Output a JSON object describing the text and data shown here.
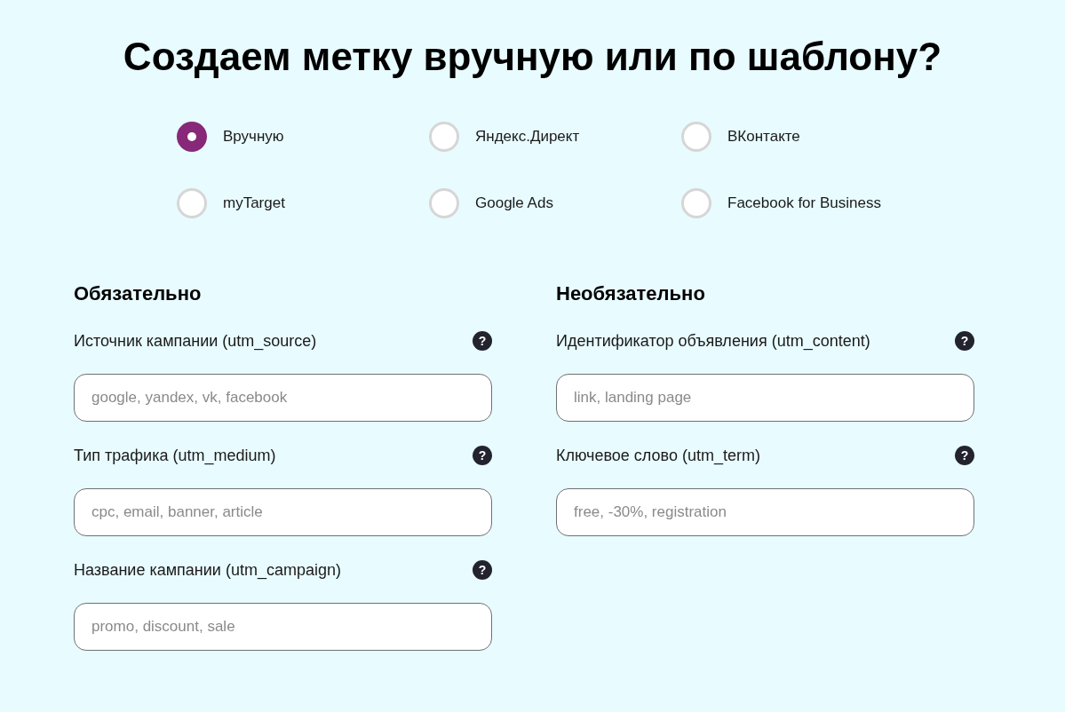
{
  "title": "Создаем метку вручную или по шаблону?",
  "options": [
    {
      "label": "Вручную",
      "selected": true
    },
    {
      "label": "Яндекс.Директ",
      "selected": false
    },
    {
      "label": "ВКонтакте",
      "selected": false
    },
    {
      "label": "myTarget",
      "selected": false
    },
    {
      "label": "Google Ads",
      "selected": false
    },
    {
      "label": "Facebook for Business",
      "selected": false
    }
  ],
  "sections": [
    {
      "heading": "Обязательно",
      "fields": [
        {
          "label": "Источник кампании (utm_source)",
          "help": "?",
          "placeholder": "google, yandex, vk, facebook"
        },
        {
          "label": "Тип трафика (utm_medium)",
          "help": "?",
          "placeholder": "cpc, email, banner, article"
        },
        {
          "label": "Название кампании (utm_campaign)",
          "help": "?",
          "placeholder": "promo, discount, sale"
        }
      ]
    },
    {
      "heading": "Необязательно",
      "fields": [
        {
          "label": "Идентификатор объявления (utm_content)",
          "help": "?",
          "placeholder": "link, landing page"
        },
        {
          "label": "Ключевое слово (utm_term)",
          "help": "?",
          "placeholder": "free, -30%, registration"
        }
      ]
    }
  ]
}
